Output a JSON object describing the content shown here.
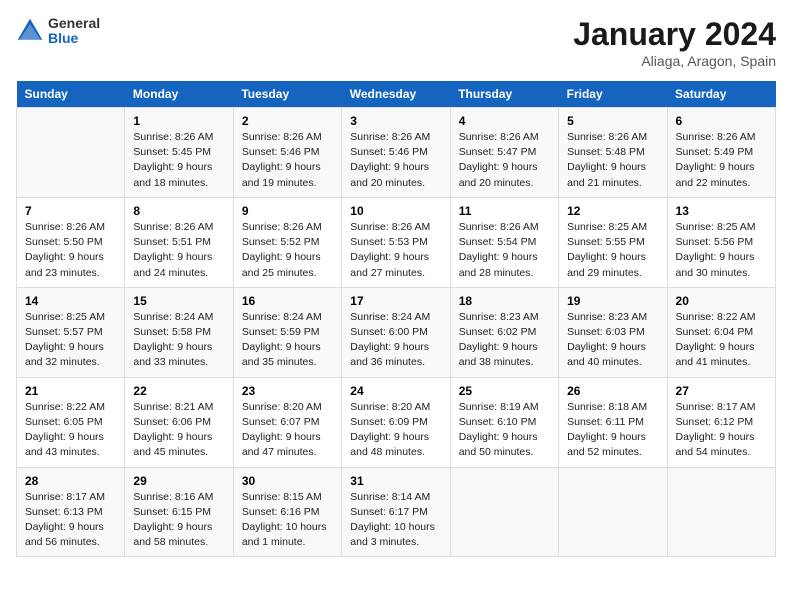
{
  "header": {
    "logo_line1": "General",
    "logo_line2": "Blue",
    "month_title": "January 2024",
    "location": "Aliaga, Aragon, Spain"
  },
  "weekdays": [
    "Sunday",
    "Monday",
    "Tuesday",
    "Wednesday",
    "Thursday",
    "Friday",
    "Saturday"
  ],
  "weeks": [
    [
      {
        "day": null,
        "info": null
      },
      {
        "day": "1",
        "info": "Sunrise: 8:26 AM\nSunset: 5:45 PM\nDaylight: 9 hours\nand 18 minutes."
      },
      {
        "day": "2",
        "info": "Sunrise: 8:26 AM\nSunset: 5:46 PM\nDaylight: 9 hours\nand 19 minutes."
      },
      {
        "day": "3",
        "info": "Sunrise: 8:26 AM\nSunset: 5:46 PM\nDaylight: 9 hours\nand 20 minutes."
      },
      {
        "day": "4",
        "info": "Sunrise: 8:26 AM\nSunset: 5:47 PM\nDaylight: 9 hours\nand 20 minutes."
      },
      {
        "day": "5",
        "info": "Sunrise: 8:26 AM\nSunset: 5:48 PM\nDaylight: 9 hours\nand 21 minutes."
      },
      {
        "day": "6",
        "info": "Sunrise: 8:26 AM\nSunset: 5:49 PM\nDaylight: 9 hours\nand 22 minutes."
      }
    ],
    [
      {
        "day": "7",
        "info": "Sunrise: 8:26 AM\nSunset: 5:50 PM\nDaylight: 9 hours\nand 23 minutes."
      },
      {
        "day": "8",
        "info": "Sunrise: 8:26 AM\nSunset: 5:51 PM\nDaylight: 9 hours\nand 24 minutes."
      },
      {
        "day": "9",
        "info": "Sunrise: 8:26 AM\nSunset: 5:52 PM\nDaylight: 9 hours\nand 25 minutes."
      },
      {
        "day": "10",
        "info": "Sunrise: 8:26 AM\nSunset: 5:53 PM\nDaylight: 9 hours\nand 27 minutes."
      },
      {
        "day": "11",
        "info": "Sunrise: 8:26 AM\nSunset: 5:54 PM\nDaylight: 9 hours\nand 28 minutes."
      },
      {
        "day": "12",
        "info": "Sunrise: 8:25 AM\nSunset: 5:55 PM\nDaylight: 9 hours\nand 29 minutes."
      },
      {
        "day": "13",
        "info": "Sunrise: 8:25 AM\nSunset: 5:56 PM\nDaylight: 9 hours\nand 30 minutes."
      }
    ],
    [
      {
        "day": "14",
        "info": "Sunrise: 8:25 AM\nSunset: 5:57 PM\nDaylight: 9 hours\nand 32 minutes."
      },
      {
        "day": "15",
        "info": "Sunrise: 8:24 AM\nSunset: 5:58 PM\nDaylight: 9 hours\nand 33 minutes."
      },
      {
        "day": "16",
        "info": "Sunrise: 8:24 AM\nSunset: 5:59 PM\nDaylight: 9 hours\nand 35 minutes."
      },
      {
        "day": "17",
        "info": "Sunrise: 8:24 AM\nSunset: 6:00 PM\nDaylight: 9 hours\nand 36 minutes."
      },
      {
        "day": "18",
        "info": "Sunrise: 8:23 AM\nSunset: 6:02 PM\nDaylight: 9 hours\nand 38 minutes."
      },
      {
        "day": "19",
        "info": "Sunrise: 8:23 AM\nSunset: 6:03 PM\nDaylight: 9 hours\nand 40 minutes."
      },
      {
        "day": "20",
        "info": "Sunrise: 8:22 AM\nSunset: 6:04 PM\nDaylight: 9 hours\nand 41 minutes."
      }
    ],
    [
      {
        "day": "21",
        "info": "Sunrise: 8:22 AM\nSunset: 6:05 PM\nDaylight: 9 hours\nand 43 minutes."
      },
      {
        "day": "22",
        "info": "Sunrise: 8:21 AM\nSunset: 6:06 PM\nDaylight: 9 hours\nand 45 minutes."
      },
      {
        "day": "23",
        "info": "Sunrise: 8:20 AM\nSunset: 6:07 PM\nDaylight: 9 hours\nand 47 minutes."
      },
      {
        "day": "24",
        "info": "Sunrise: 8:20 AM\nSunset: 6:09 PM\nDaylight: 9 hours\nand 48 minutes."
      },
      {
        "day": "25",
        "info": "Sunrise: 8:19 AM\nSunset: 6:10 PM\nDaylight: 9 hours\nand 50 minutes."
      },
      {
        "day": "26",
        "info": "Sunrise: 8:18 AM\nSunset: 6:11 PM\nDaylight: 9 hours\nand 52 minutes."
      },
      {
        "day": "27",
        "info": "Sunrise: 8:17 AM\nSunset: 6:12 PM\nDaylight: 9 hours\nand 54 minutes."
      }
    ],
    [
      {
        "day": "28",
        "info": "Sunrise: 8:17 AM\nSunset: 6:13 PM\nDaylight: 9 hours\nand 56 minutes."
      },
      {
        "day": "29",
        "info": "Sunrise: 8:16 AM\nSunset: 6:15 PM\nDaylight: 9 hours\nand 58 minutes."
      },
      {
        "day": "30",
        "info": "Sunrise: 8:15 AM\nSunset: 6:16 PM\nDaylight: 10 hours\nand 1 minute."
      },
      {
        "day": "31",
        "info": "Sunrise: 8:14 AM\nSunset: 6:17 PM\nDaylight: 10 hours\nand 3 minutes."
      },
      {
        "day": null,
        "info": null
      },
      {
        "day": null,
        "info": null
      },
      {
        "day": null,
        "info": null
      }
    ]
  ]
}
